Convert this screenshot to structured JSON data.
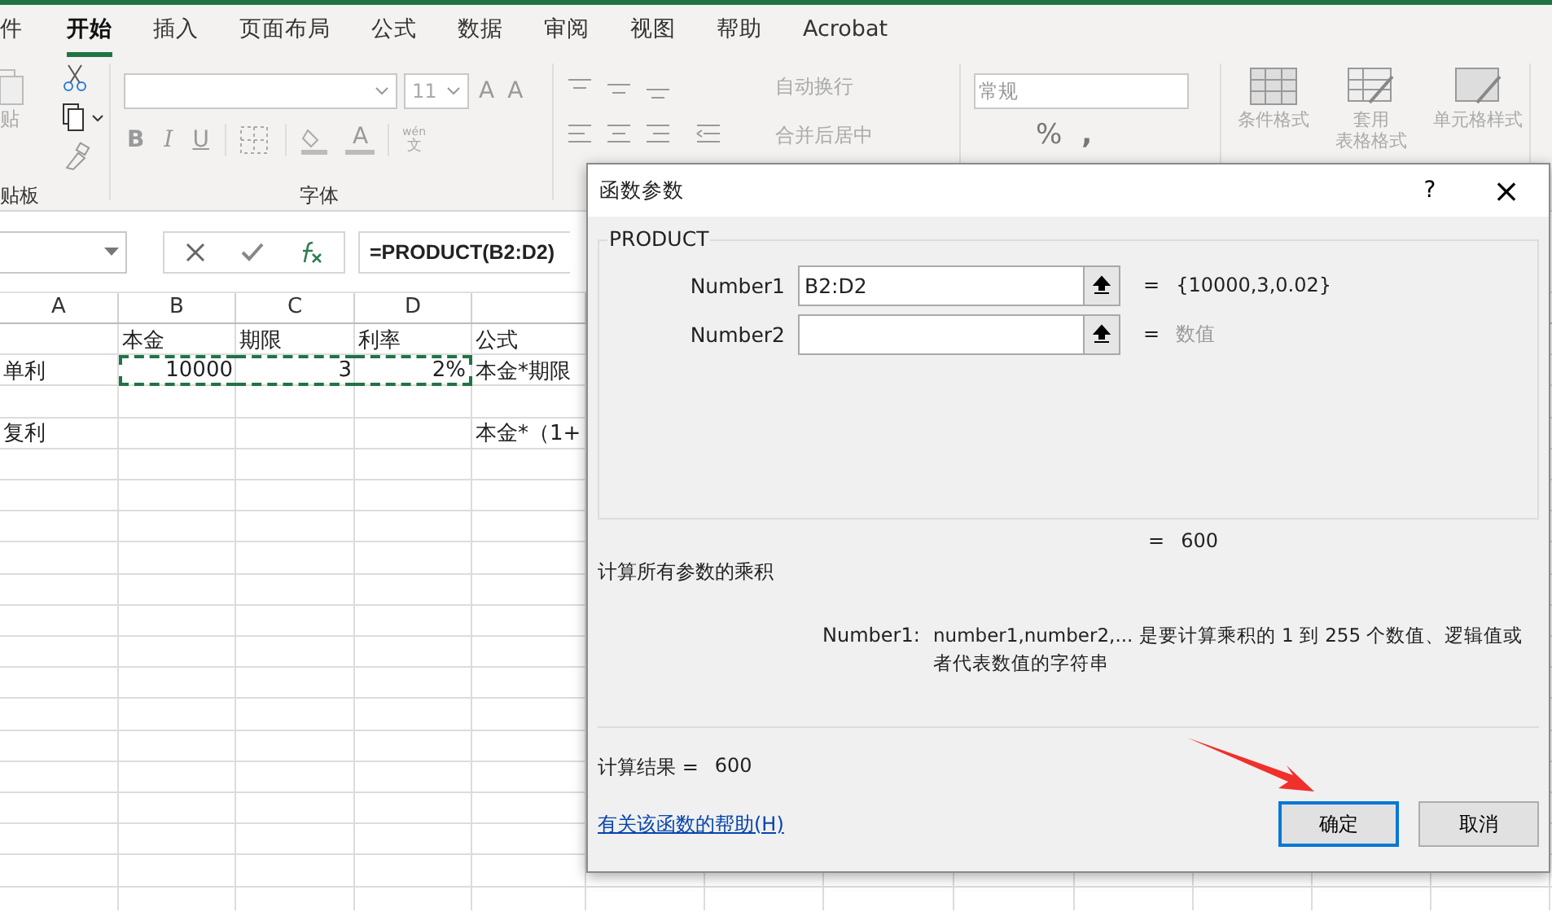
{
  "ribbon_tabs": [
    {
      "label": "件",
      "selected": false
    },
    {
      "label": "开始",
      "selected": true
    },
    {
      "label": "插入",
      "selected": false
    },
    {
      "label": "页面布局",
      "selected": false
    },
    {
      "label": "公式",
      "selected": false
    },
    {
      "label": "数据",
      "selected": false
    },
    {
      "label": "审阅",
      "selected": false
    },
    {
      "label": "视图",
      "selected": false
    },
    {
      "label": "帮助",
      "selected": false
    },
    {
      "label": "Acrobat",
      "selected": false
    }
  ],
  "ribbon": {
    "clipboard": {
      "paste_label": "贴",
      "group_label": "贴板"
    },
    "font": {
      "font_size": "11",
      "grow": "A",
      "shrink": "A",
      "bold": "B",
      "italic": "I",
      "underline": "U",
      "font_color": "A",
      "phonetic_top": "wén",
      "phonetic_bottom": "文",
      "group_label": "字体"
    },
    "alignment": {
      "wrap_text": "自动换行",
      "merge_center": "合并后居中"
    },
    "number": {
      "format": "常规",
      "percent": "%",
      "comma": ","
    },
    "styles": {
      "conditional": "条件格式",
      "table_format_top": "套用",
      "table_format_bottom": "表格格式",
      "cell_styles": "单元格样式"
    }
  },
  "formula_bar": {
    "formula": "=PRODUCT(B2:D2)"
  },
  "columns": [
    "A",
    "B",
    "C",
    "D"
  ],
  "rows": [
    {
      "cells": [
        {
          "kind": "empty"
        },
        {
          "text": "本金",
          "kind": "text",
          "in_marquee": false
        },
        {
          "text": "期限",
          "kind": "text",
          "in_marquee": false
        },
        {
          "text": "利率",
          "kind": "text",
          "in_marquee": false
        },
        {
          "text": "公式",
          "kind": "text",
          "in_marquee": false
        }
      ]
    },
    {
      "cells": [
        {
          "text": "单利",
          "kind": "text",
          "in_marquee": false
        },
        {
          "text": "10000",
          "kind": "number",
          "in_marquee": true
        },
        {
          "text": "3",
          "kind": "number",
          "in_marquee": true
        },
        {
          "text": "2%",
          "kind": "number",
          "in_marquee": true
        },
        {
          "text": "本金*期限",
          "kind": "text",
          "in_marquee": false
        }
      ]
    },
    {
      "cells": [
        {
          "kind": "empty"
        }
      ]
    },
    {
      "cells": [
        {
          "text": "复利",
          "kind": "text",
          "in_marquee": false
        },
        {
          "kind": "empty"
        },
        {
          "kind": "empty"
        },
        {
          "kind": "empty"
        },
        {
          "text": "本金*（1+",
          "kind": "text",
          "in_marquee": false
        }
      ]
    }
  ],
  "dialog": {
    "title": "函数参数",
    "help_button": "?",
    "close_button": "×",
    "function_name": "PRODUCT",
    "arguments": [
      {
        "label": "Number1",
        "value": "B2:D2",
        "result": "{10000,3,0.02}",
        "result_dim": false
      },
      {
        "label": "Number2",
        "result": "数值",
        "result_dim": true
      }
    ],
    "equals": "=",
    "formula_result": "600",
    "description": "计算所有参数的乘积",
    "arg_help_label": "Number1:",
    "arg_help_text": "number1,number2,... 是要计算乘积的 1 到 255 个数值、逻辑值或者代表数值的字符串",
    "result_label": "计算结果 =",
    "result_value": "600",
    "help_link": "有关该函数的帮助(H)",
    "buttons": [
      {
        "label": "确定",
        "default": true
      },
      {
        "label": "取消",
        "default": false
      }
    ]
  }
}
